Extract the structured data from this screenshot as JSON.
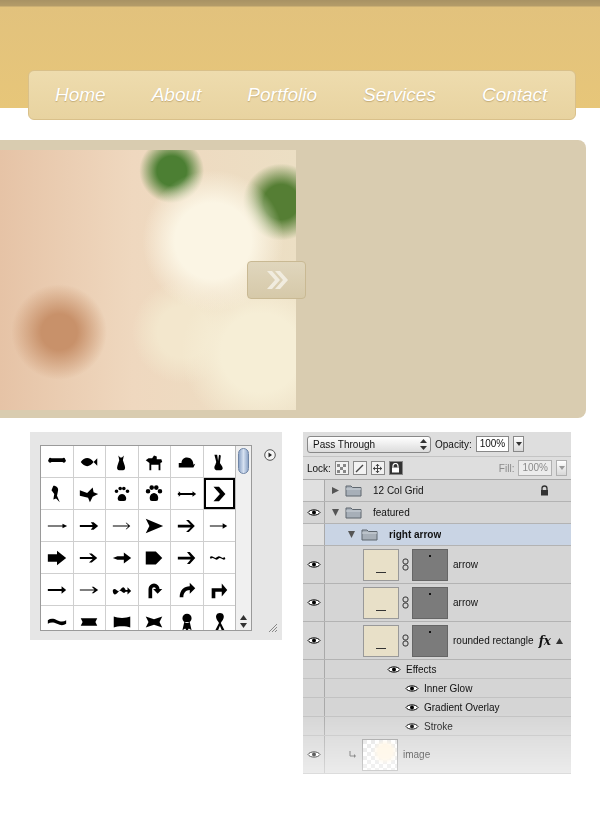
{
  "nav": [
    {
      "label": "Home"
    },
    {
      "label": "About"
    },
    {
      "label": "Portfolio"
    },
    {
      "label": "Services"
    },
    {
      "label": "Contact"
    }
  ],
  "shapes": [
    {
      "selected": false
    },
    {
      "selected": false
    },
    {
      "selected": false
    },
    {
      "selected": false
    },
    {
      "selected": false
    },
    {
      "selected": false
    },
    {
      "selected": false
    },
    {
      "selected": false
    },
    {
      "selected": false
    },
    {
      "selected": false
    },
    {
      "selected": false
    },
    {
      "selected": true
    },
    {
      "selected": false
    },
    {
      "selected": false
    },
    {
      "selected": false
    },
    {
      "selected": false
    },
    {
      "selected": false
    },
    {
      "selected": false
    },
    {
      "selected": false
    },
    {
      "selected": false
    },
    {
      "selected": false
    },
    {
      "selected": false
    },
    {
      "selected": false
    },
    {
      "selected": false
    },
    {
      "selected": false
    },
    {
      "selected": false
    },
    {
      "selected": false
    },
    {
      "selected": false
    },
    {
      "selected": false
    },
    {
      "selected": false
    },
    {
      "selected": false
    },
    {
      "selected": false
    },
    {
      "selected": false
    },
    {
      "selected": false
    },
    {
      "selected": false
    },
    {
      "selected": false
    }
  ],
  "layers_panel": {
    "blend_mode": "Pass Through",
    "opacity_label": "Opacity:",
    "opacity": "100%",
    "lock_label": "Lock:",
    "fill_label": "Fill:",
    "fill": "100%",
    "fill_disabled": true,
    "layers": [
      {
        "name": "12 Col Grid",
        "kind": "group",
        "visible": false,
        "expanded": false,
        "locked": true,
        "selected": false,
        "children": []
      },
      {
        "name": "featured",
        "kind": "group",
        "visible": true,
        "expanded": true,
        "locked": false,
        "selected": false,
        "children": [
          {
            "name": "right arrow",
            "kind": "group",
            "visible": false,
            "expanded": true,
            "locked": false,
            "selected": true,
            "children": [
              {
                "name": "arrow",
                "kind": "shape",
                "visible": true,
                "selected": false,
                "clipped": false
              },
              {
                "name": "arrow",
                "kind": "shape",
                "visible": true,
                "selected": false,
                "clipped": false
              },
              {
                "name": "rounded rectangle",
                "kind": "shape",
                "visible": true,
                "selected": false,
                "clipped": false,
                "effects": {
                  "badge": "fx",
                  "label": "Effects",
                  "visible": true,
                  "expanded": true,
                  "items": [
                    {
                      "name": "Inner Glow",
                      "visible": true
                    },
                    {
                      "name": "Gradient Overlay",
                      "visible": true
                    },
                    {
                      "name": "Stroke",
                      "visible": true
                    }
                  ]
                }
              }
            ]
          },
          {
            "name": "image",
            "kind": "image",
            "visible": true,
            "selected": false,
            "clipped": true
          }
        ]
      }
    ]
  }
}
